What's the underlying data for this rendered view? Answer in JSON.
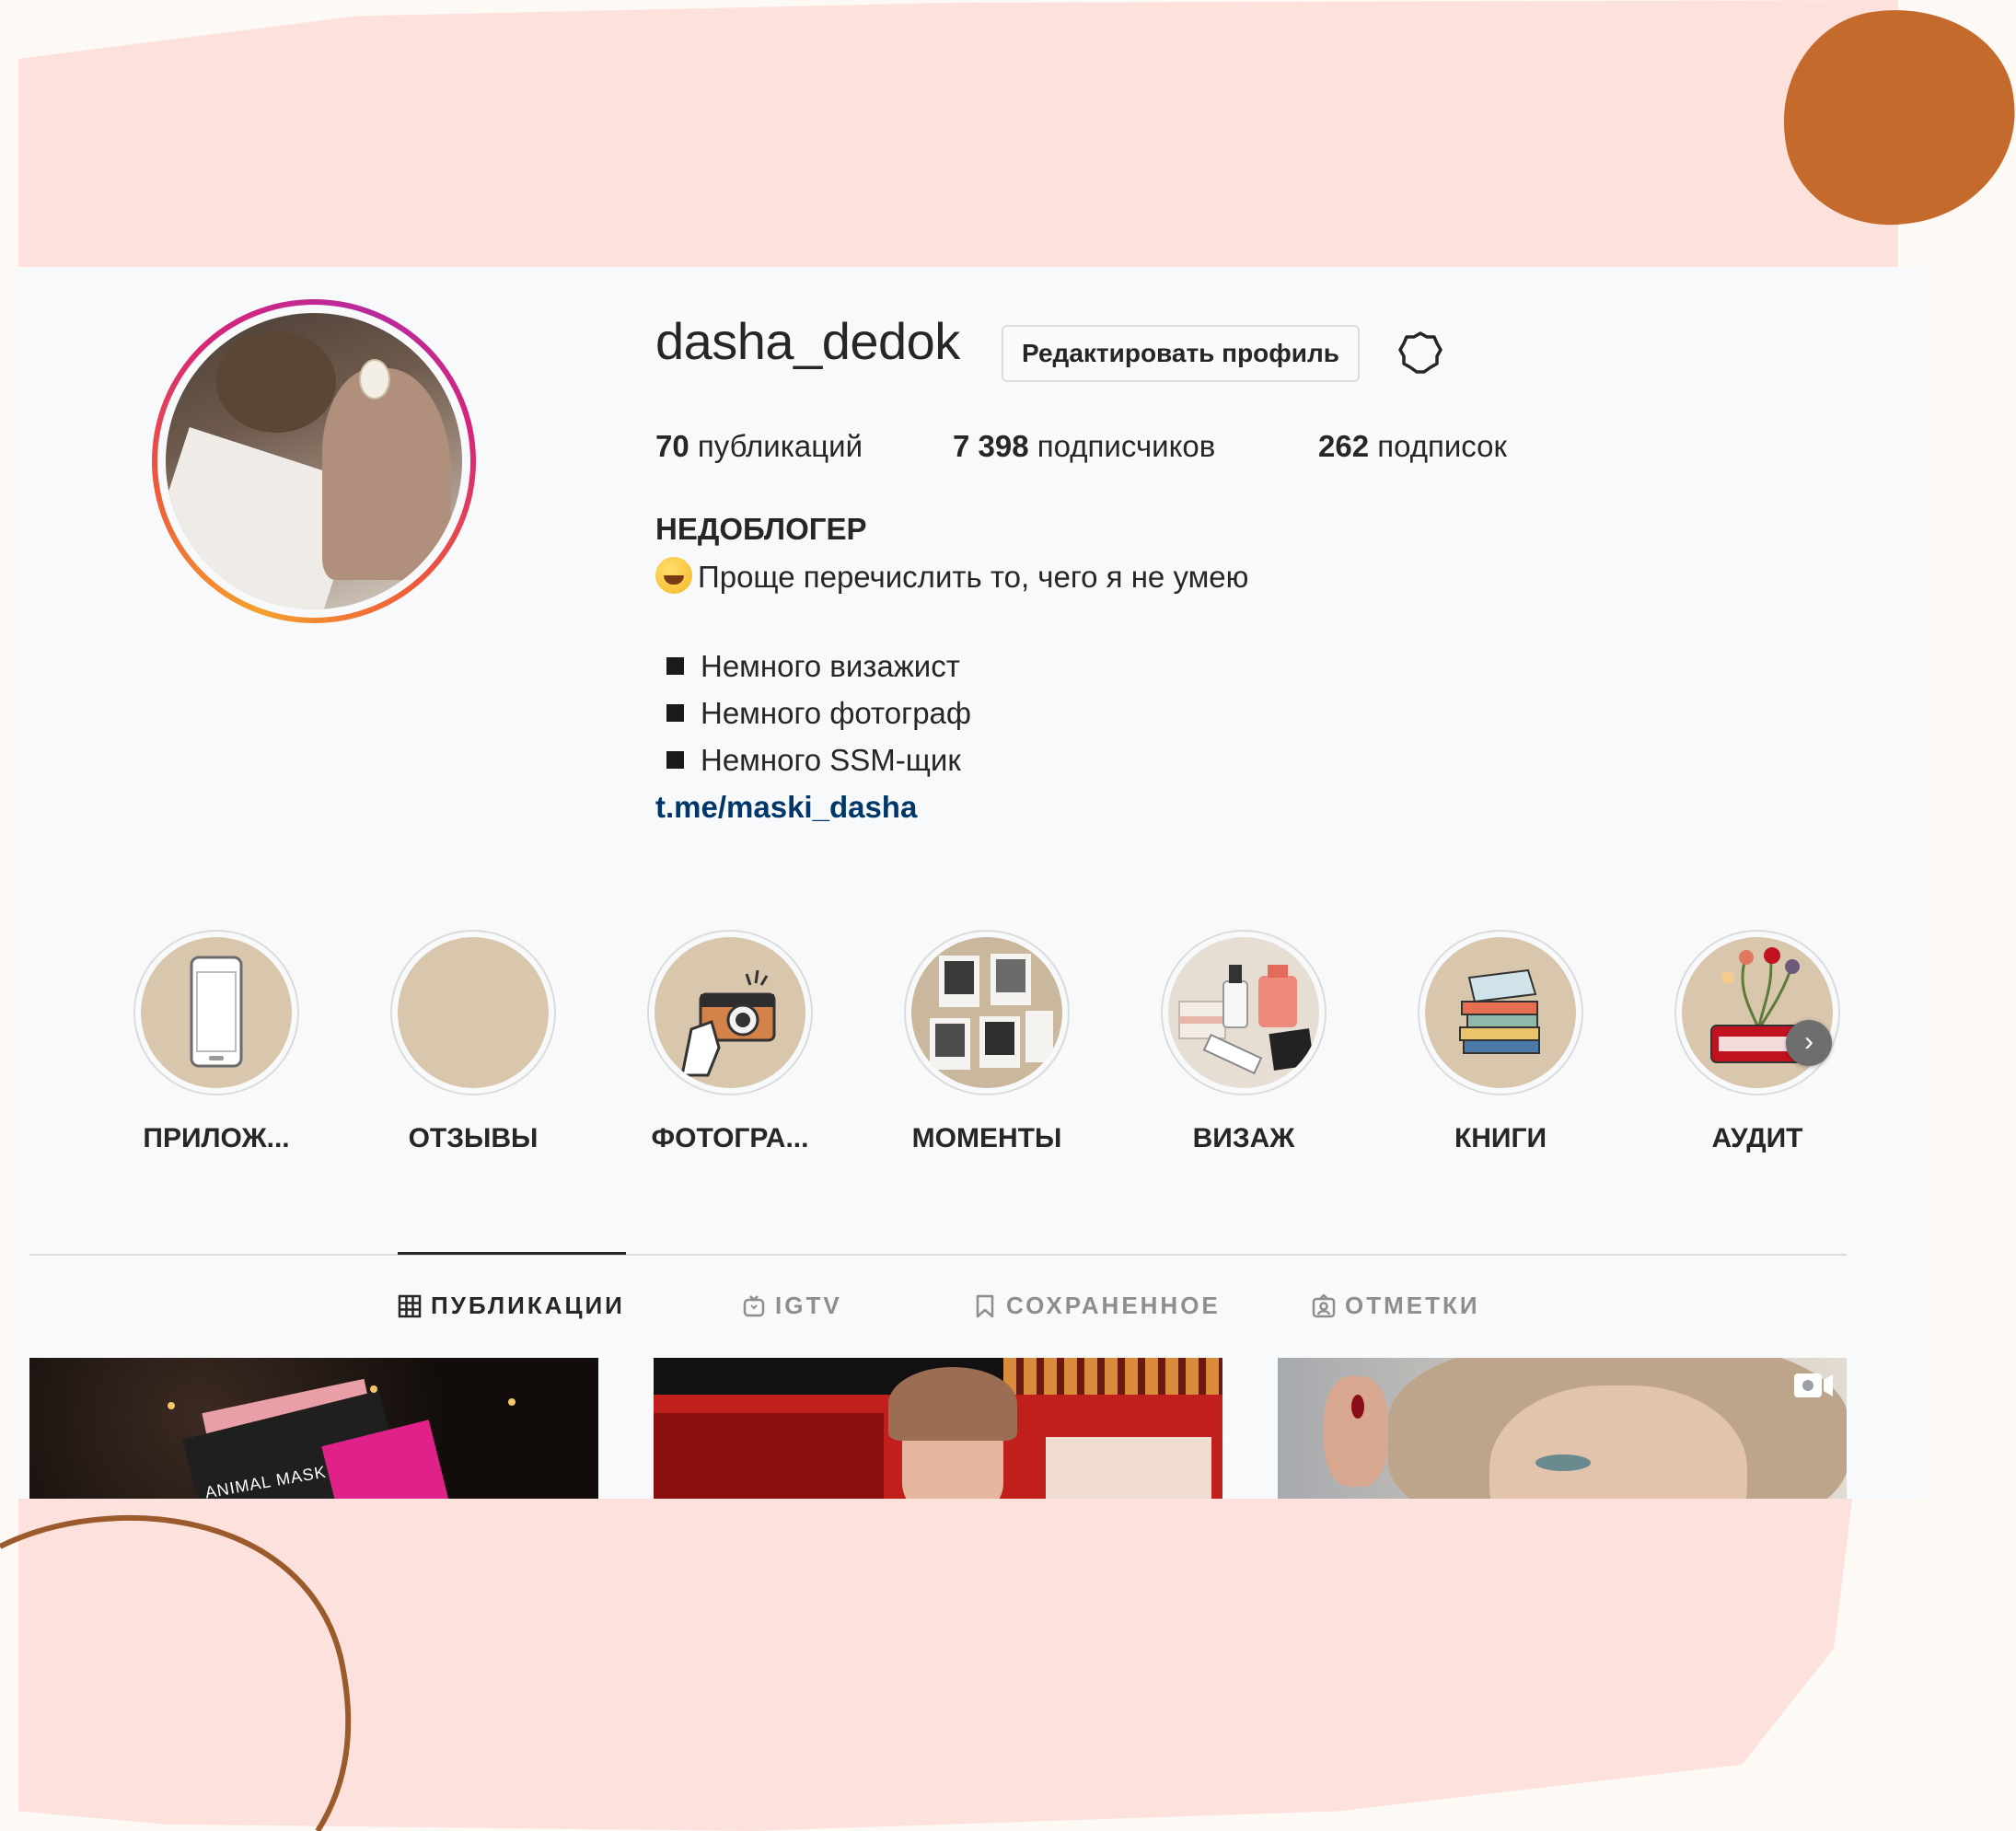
{
  "profile": {
    "username": "dasha_dedok",
    "edit_button_label": "Редактировать профиль",
    "settings_icon": "gear-icon",
    "stats": {
      "posts_count": "70",
      "posts_label": "публикаций",
      "followers_count": "7 398",
      "followers_label": "подписчиков",
      "following_count": "262",
      "following_label": "подписок"
    },
    "full_name": "НЕДОБЛОГЕР",
    "bio": {
      "line1": "Проще перечислить то, чего я не умею",
      "items": [
        "Немного визажист",
        "Немного фотограф",
        "Немного SSM-щик"
      ],
      "link": "t.me/maski_dasha"
    }
  },
  "highlights": [
    {
      "label": "ПРИЛОЖ...",
      "icon": "phone-icon"
    },
    {
      "label": "ОТЗЫВЫ",
      "icon": "blank-highlight"
    },
    {
      "label": "ФОТОГРА...",
      "icon": "camera-icon"
    },
    {
      "label": "МОМЕНТЫ",
      "icon": "photos-icon"
    },
    {
      "label": "ВИЗАЖ",
      "icon": "cosmetics-icon"
    },
    {
      "label": "КНИГИ",
      "icon": "books-icon"
    },
    {
      "label": "АУДИТ",
      "icon": "typewriter-icon"
    }
  ],
  "tabs": [
    {
      "label": "ПУБЛИКАЦИИ",
      "icon": "grid-icon",
      "active": true
    },
    {
      "label": "IGTV",
      "icon": "igtv-icon",
      "active": false
    },
    {
      "label": "СОХРАНЕННОЕ",
      "icon": "bookmark-icon",
      "active": false
    },
    {
      "label": "ОТМЕТКИ",
      "icon": "tagged-icon",
      "active": false
    }
  ],
  "posts": [
    {
      "caption": "ANIMAL MASK"
    },
    {
      "caption": ""
    },
    {
      "caption": "",
      "badge_icon": "video-icon"
    }
  ],
  "colors": {
    "accent_bg": "#fde1dc",
    "blob": "#c46a2c",
    "link": "#00376b",
    "text": "#262626",
    "muted": "#8e8e8e"
  }
}
